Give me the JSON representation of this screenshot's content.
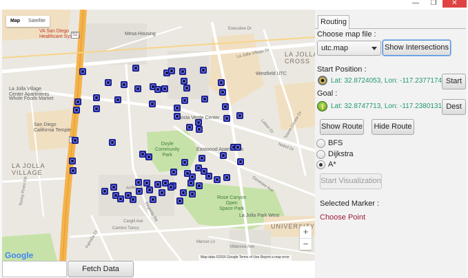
{
  "window": {
    "minimize_glyph": "—",
    "maximize_glyph": "❐",
    "close_glyph": "✕"
  },
  "map": {
    "map_type": {
      "map": "Map",
      "satellite": "Satellite"
    },
    "labels": {
      "va_hospital": "VA San Diego\nHealthcare System",
      "mesa_housing": "Mesa Housing",
      "executive_dr": "Executive Dr",
      "la_jolla_village_dr": "La Jolla Village Dr",
      "westfield": "Westfield UTC",
      "lj_village_apts": "La Jolla Village\nCenter Apartments",
      "whole_foods": "Whole Foods Market",
      "costa_verde": "Costa Verde Center",
      "california_temple": "San Diego\nCalifornia Temple",
      "la_jolla_village": "LA JOLLA\nVILLAGE",
      "doyle_park": "Doyle\nCommunity\nPark",
      "eastwood_apts": "Eastwood Apartments",
      "la_jolla_cross": "LA JOLLA\nCROSS",
      "rose_canyon": "Rose Canyon\nOpen\nSpace Park",
      "la_jolla_park_west": "La Jolla Park West",
      "university": "UNIVERSITY",
      "arriba_st": "Arriba St",
      "genesee_ave": "Genesee Ave",
      "nobel_dr": "Nobel Dr",
      "regents_rd": "Regents Rd",
      "mercer_ln": "Mercer Ln",
      "villanova_ave": "Villanova Ave",
      "palmilla_dr": "Palmilla Dr",
      "cargill_ave": "Cargill Ave",
      "camino_tunco": "Camino Tunco",
      "torrey_pines_rd": "Torrey Pines Rd",
      "towne_centre_dr": "Towne Centre Dr",
      "lebon_dr": "Lebon Dr",
      "route_5_shield": "5",
      "route_52_shield": "52"
    },
    "google_logo": "Google",
    "attribution": "Map data ©2016 Google  Terms of Use  Report a map error",
    "zoom_in": "+",
    "zoom_out": "−"
  },
  "bottom": {
    "fetch_label": "Fetch Data",
    "field_value": ""
  },
  "panel": {
    "tab_label": "Routing",
    "choose_map_label": "Choose map file :",
    "map_file_value": "utc.map",
    "show_intersections_label": "Show Intersections",
    "start_position_label": "Start Position :",
    "start_coords": "Lat: 32.8724053, Lon: -117.2377174",
    "start_button_label": "Start",
    "goal_label": "Goal :",
    "goal_coords": "Lat: 32.8747713, Lon: -117.2380131",
    "dest_button_label": "Dest",
    "show_route_label": "Show Route",
    "hide_route_label": "Hide Route",
    "algorithms": [
      {
        "label": "BFS",
        "selected": false
      },
      {
        "label": "Dijkstra",
        "selected": false
      },
      {
        "label": "A*",
        "selected": true
      }
    ],
    "start_visualization_label": "Start Visualization",
    "selected_marker_label": "Selected Marker :",
    "choose_point_label": "Choose Point"
  },
  "colors": {
    "marker_fill": "#2e34c0",
    "coords_text": "#1f9a6a",
    "choose_point_text": "#9b1c3a",
    "highway": "#f4b34d",
    "park": "#c6e2a8"
  }
}
